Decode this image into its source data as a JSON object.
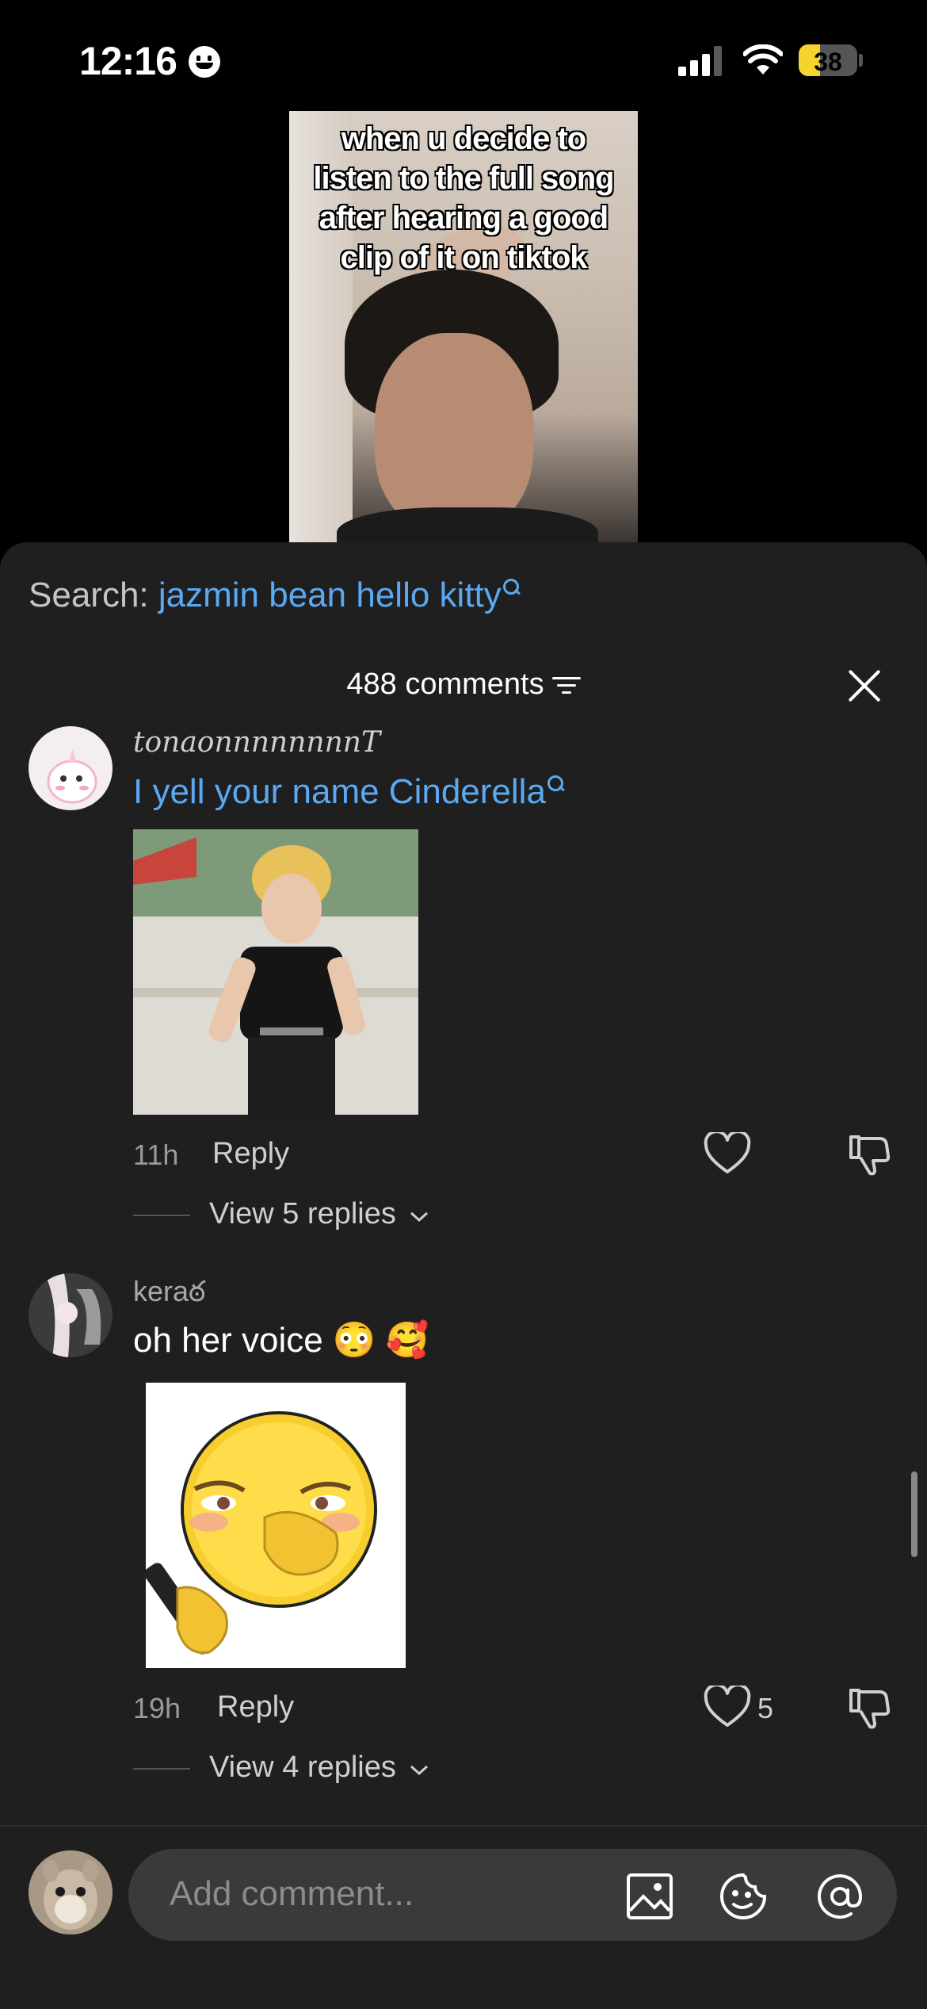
{
  "status_bar": {
    "time": "12:16",
    "battery": "38"
  },
  "video": {
    "caption_lines": "when u decide to\nlisten to the full song\nafter hearing a good\nclip of it on tiktok"
  },
  "search": {
    "label": "Search:",
    "query": "jazmin bean hello kitty"
  },
  "header": {
    "comment_count": "488 comments"
  },
  "comments": [
    {
      "username": "tonaonnnnnnnnT",
      "text": "I yell your name Cinderella",
      "time": "11h",
      "reply_label": "Reply",
      "likes": "",
      "view_replies": "View 5 replies"
    },
    {
      "username": "keraఠ",
      "text": "oh her voice 😳 🥰",
      "time": "19h",
      "reply_label": "Reply",
      "likes": "5",
      "view_replies": "View 4 replies"
    }
  ],
  "composer": {
    "placeholder": "Add comment..."
  },
  "colors": {
    "accent": "#5aa9f2",
    "sheet": "#1f1f1f",
    "battery": "#f6d32d"
  }
}
